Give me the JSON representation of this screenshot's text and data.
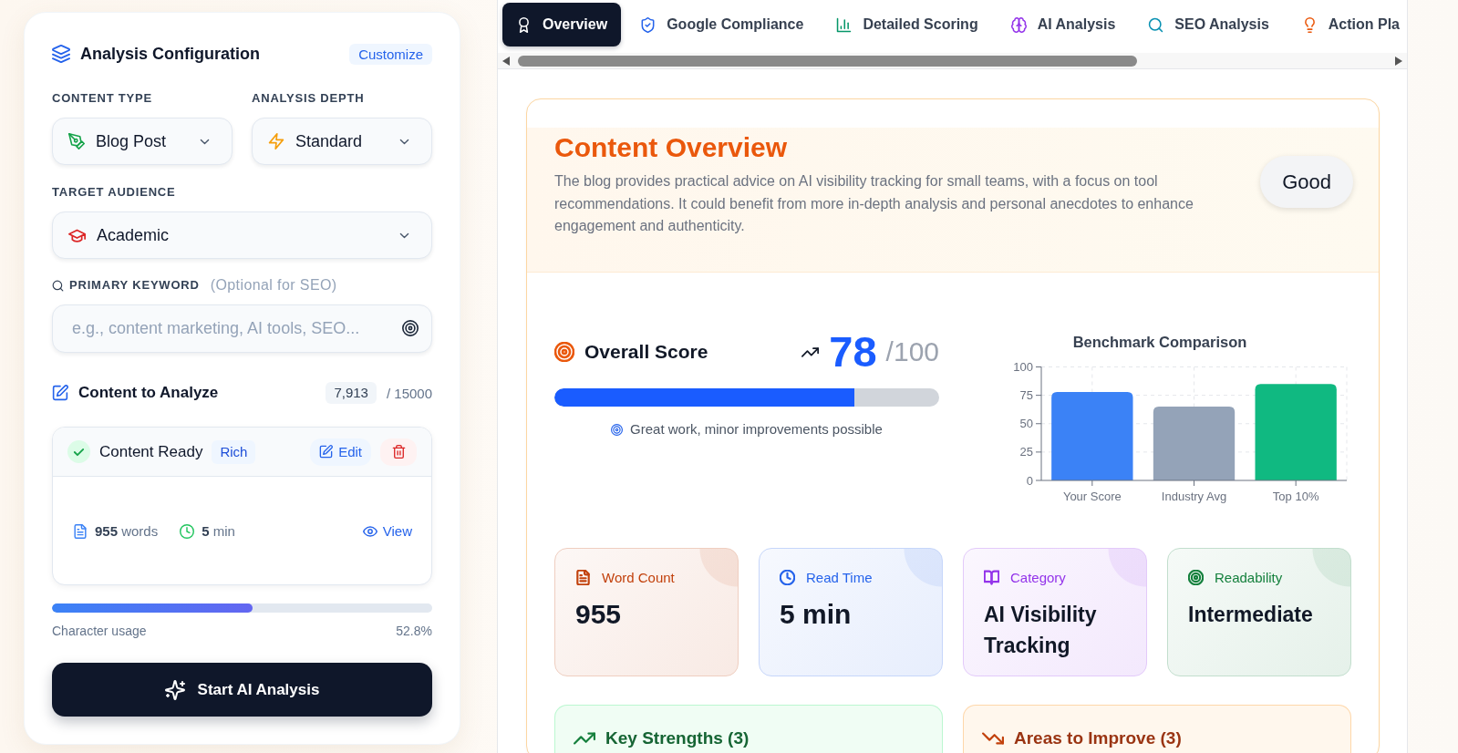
{
  "config_panel": {
    "title": "Analysis Configuration",
    "customize_button": "Customize",
    "content_type": {
      "label": "CONTENT TYPE",
      "value": "Blog Post"
    },
    "analysis_depth": {
      "label": "ANALYSIS DEPTH",
      "value": "Standard"
    },
    "target_audience": {
      "label": "TARGET AUDIENCE",
      "value": "Academic"
    },
    "primary_keyword": {
      "label": "PRIMARY KEYWORD",
      "hint": "(Optional for SEO)",
      "placeholder": "e.g., content marketing, AI tools, SEO..."
    },
    "content": {
      "title": "Content to Analyze",
      "character_count": "7,913",
      "character_limit": "/ 15000",
      "status": "Content Ready",
      "quality_badge": "Rich",
      "edit_button": "Edit",
      "word_count": "**955** words",
      "read_time": "**5** min",
      "view_link": "View"
    },
    "usage": {
      "label": "Character usage",
      "reading": "52.8%",
      "level": 0.528
    },
    "start_button": "Start AI Analysis"
  },
  "tabs": [
    {
      "kind": "overview",
      "label": "Overview",
      "selected": true
    },
    {
      "kind": "compliance",
      "label": "Google Compliance",
      "selected": false
    },
    {
      "kind": "scoring",
      "label": "Detailed Scoring",
      "selected": false
    },
    {
      "kind": "ai",
      "label": "AI Analysis",
      "selected": false
    },
    {
      "kind": "seo",
      "label": "SEO Analysis",
      "selected": false
    },
    {
      "kind": "actions",
      "label": "Action Pla",
      "selected": false
    }
  ],
  "overview": {
    "title": "Content Overview",
    "summary": "The blog provides practical advice on AI visibility tracking for small teams, with a focus on tool recommendations. It could benefit from more in-depth analysis and personal anecdotes to enhance engagement and authenticity.",
    "rating": "Good",
    "score": {
      "label": "Overall Score",
      "value": "78",
      "max": "/100",
      "level": 0.78,
      "note": "Great work, minor improvements possible"
    },
    "benchmark": {
      "chart_data": {
        "type": "bar",
        "title": "Benchmark Comparison",
        "categories": [
          "Your Score",
          "Industry Avg",
          "Top 10%"
        ],
        "values": [
          78,
          65,
          85
        ],
        "colors": [
          "#3b82f6",
          "#94a3b8",
          "#10b981"
        ],
        "ylim": [
          0,
          100
        ],
        "yticks": [
          0,
          25,
          50,
          75,
          100
        ],
        "grid": true
      }
    },
    "stats": [
      {
        "kind": "word_count",
        "label": "Word Count",
        "value": "955",
        "color": "#c2410c"
      },
      {
        "kind": "read_time",
        "label": "Read Time",
        "value": "5 min",
        "color": "#2563eb"
      },
      {
        "kind": "category",
        "label": "Category",
        "value": "AI Visibility Tracking",
        "color": "#9333ea"
      },
      {
        "kind": "readability",
        "label": "Readability",
        "value": "Intermediate",
        "color": "#15803d"
      }
    ],
    "sections": [
      {
        "kind": "strengths",
        "title": "Key Strengths (3)"
      },
      {
        "kind": "improvements",
        "title": "Areas to Improve (3)"
      }
    ]
  }
}
